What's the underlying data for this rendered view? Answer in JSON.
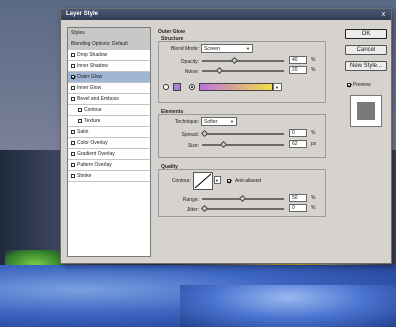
{
  "dialog": {
    "title": "Layer Style",
    "close": "x"
  },
  "styles_list": [
    {
      "label": "Styles",
      "type": "header"
    },
    {
      "label": "Blending Options: Default",
      "type": "header"
    },
    {
      "label": "Drop Shadow",
      "checked": false
    },
    {
      "label": "Inner Shadow",
      "checked": false
    },
    {
      "label": "Outer Glow",
      "checked": true,
      "selected": true
    },
    {
      "label": "Inner Glow",
      "checked": false
    },
    {
      "label": "Bevel and Emboss",
      "checked": false
    },
    {
      "label": "Contour",
      "checked": false,
      "indent": true
    },
    {
      "label": "Texture",
      "checked": false,
      "indent": true
    },
    {
      "label": "Satin",
      "checked": false
    },
    {
      "label": "Color Overlay",
      "checked": false
    },
    {
      "label": "Gradient Overlay",
      "checked": false
    },
    {
      "label": "Pattern Overlay",
      "checked": false
    },
    {
      "label": "Stroke",
      "checked": false
    }
  ],
  "outer_glow": {
    "title": "Outer Glow",
    "structure": {
      "title": "Structure",
      "blend_mode_label": "Blend Mode:",
      "blend_mode_value": "Screen",
      "opacity_label": "Opacity:",
      "opacity_value": "40",
      "opacity_level": 0.4,
      "noise_label": "Noise:",
      "noise_value": "20",
      "noise_level": 0.2,
      "unit": "%"
    },
    "elements": {
      "title": "Elements",
      "technique_label": "Technique:",
      "technique_value": "Softer",
      "spread_label": "Spread:",
      "spread_value": "0",
      "spread_level": 0,
      "spread_unit": "%",
      "size_label": "Size:",
      "size_value": "62",
      "size_level": 0.25,
      "size_unit": "px"
    },
    "quality": {
      "title": "Quality",
      "contour_label": "Contour:",
      "anti_aliased_label": "Anti-aliased",
      "anti_aliased": true,
      "range_label": "Range:",
      "range_value": "50",
      "range_level": 0.5,
      "range_unit": "%",
      "jitter_label": "Jitter:",
      "jitter_value": "0",
      "jitter_level": 0,
      "jitter_unit": "%"
    },
    "colors": {
      "solid": "#b080d0",
      "gradient_start": "#c070e0",
      "gradient_end": "#f0e040"
    }
  },
  "buttons": {
    "ok": "OK",
    "cancel": "Cancel",
    "new_style": "New Style...",
    "preview_label": "Preview",
    "preview_checked": true
  }
}
